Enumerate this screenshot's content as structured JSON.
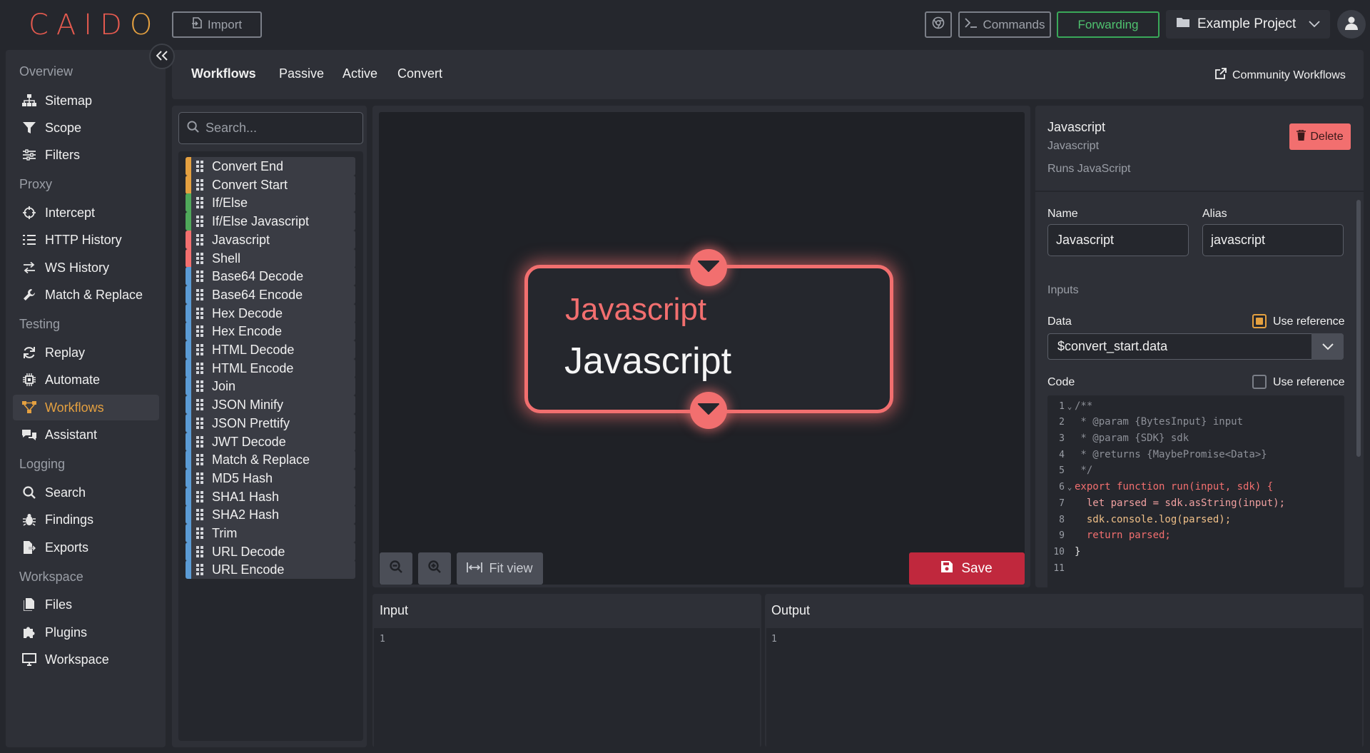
{
  "app": {
    "logo_text": "CAIDO",
    "accent": "#e4a040",
    "brand_color": "#e55a4f"
  },
  "topbar": {
    "import_label": "Import",
    "commands_label": "Commands",
    "forwarding_label": "Forwarding",
    "forwarding_color": "#4fc16f",
    "project_name": "Example Project"
  },
  "sidebar": {
    "sections": [
      {
        "title": "Overview",
        "items": [
          {
            "label": "Sitemap",
            "icon": "sitemap-icon"
          },
          {
            "label": "Scope",
            "icon": "funnel-icon"
          },
          {
            "label": "Filters",
            "icon": "sliders-icon"
          }
        ]
      },
      {
        "title": "Proxy",
        "items": [
          {
            "label": "Intercept",
            "icon": "crosshair-icon"
          },
          {
            "label": "HTTP History",
            "icon": "list-icon"
          },
          {
            "label": "WS History",
            "icon": "exchange-icon"
          },
          {
            "label": "Match & Replace",
            "icon": "wrench-icon"
          }
        ]
      },
      {
        "title": "Testing",
        "items": [
          {
            "label": "Replay",
            "icon": "refresh-icon"
          },
          {
            "label": "Automate",
            "icon": "chip-icon"
          },
          {
            "label": "Workflows",
            "icon": "workflow-icon"
          },
          {
            "label": "Assistant",
            "icon": "chat-icon"
          }
        ]
      },
      {
        "title": "Logging",
        "items": [
          {
            "label": "Search",
            "icon": "search-icon"
          },
          {
            "label": "Findings",
            "icon": "bug-icon"
          },
          {
            "label": "Exports",
            "icon": "file-export-icon"
          }
        ]
      },
      {
        "title": "Workspace",
        "items": [
          {
            "label": "Files",
            "icon": "files-icon"
          },
          {
            "label": "Plugins",
            "icon": "puzzle-icon"
          },
          {
            "label": "Workspace",
            "icon": "monitor-icon"
          }
        ]
      }
    ],
    "active_item": "Workflows"
  },
  "tabs": {
    "items": [
      "Workflows",
      "Passive",
      "Active",
      "Convert"
    ],
    "active": "Workflows",
    "community_label": "Community Workflows"
  },
  "nodes": {
    "search_placeholder": "Search...",
    "items": [
      {
        "label": "Convert End",
        "color": "#e4a040"
      },
      {
        "label": "Convert Start",
        "color": "#e4a040"
      },
      {
        "label": "If/Else",
        "color": "#4fa85a"
      },
      {
        "label": "If/Else Javascript",
        "color": "#4fa85a"
      },
      {
        "label": "Javascript",
        "color": "#f26f6f"
      },
      {
        "label": "Shell",
        "color": "#f26f6f"
      },
      {
        "label": "Base64 Decode",
        "color": "#5b9bd5"
      },
      {
        "label": "Base64 Encode",
        "color": "#5b9bd5"
      },
      {
        "label": "Hex Decode",
        "color": "#5b9bd5"
      },
      {
        "label": "Hex Encode",
        "color": "#5b9bd5"
      },
      {
        "label": "HTML Decode",
        "color": "#5b9bd5"
      },
      {
        "label": "HTML Encode",
        "color": "#5b9bd5"
      },
      {
        "label": "Join",
        "color": "#5b9bd5"
      },
      {
        "label": "JSON Minify",
        "color": "#5b9bd5"
      },
      {
        "label": "JSON Prettify",
        "color": "#5b9bd5"
      },
      {
        "label": "JWT Decode",
        "color": "#5b9bd5"
      },
      {
        "label": "Match & Replace",
        "color": "#5b9bd5"
      },
      {
        "label": "MD5 Hash",
        "color": "#5b9bd5"
      },
      {
        "label": "SHA1 Hash",
        "color": "#5b9bd5"
      },
      {
        "label": "SHA2 Hash",
        "color": "#5b9bd5"
      },
      {
        "label": "Trim",
        "color": "#5b9bd5"
      },
      {
        "label": "URL Decode",
        "color": "#5b9bd5"
      },
      {
        "label": "URL Encode",
        "color": "#5b9bd5"
      }
    ]
  },
  "canvas": {
    "node_title": "Javascript",
    "node_subtitle": "Javascript",
    "fit_view_label": "Fit view",
    "save_label": "Save"
  },
  "details": {
    "title": "Javascript",
    "subtitle": "Javascript",
    "description": "Runs JavaScript",
    "delete_label": "Delete",
    "name_label": "Name",
    "name_value": "Javascript",
    "alias_label": "Alias",
    "alias_value": "javascript",
    "inputs_label": "Inputs",
    "data_label": "Data",
    "data_use_reference_label": "Use reference",
    "data_use_reference": true,
    "data_value": "$convert_start.data",
    "code_label": "Code",
    "code_use_reference_label": "Use reference",
    "code_use_reference": false,
    "code_lines": [
      "/**",
      " * @param {BytesInput} input",
      " * @param {SDK} sdk",
      " * @returns {MaybePromise<Data>}",
      " */",
      "export function run(input, sdk) {",
      "  let parsed = sdk.asString(input);",
      "  sdk.console.log(parsed);",
      "  return parsed;",
      "}",
      ""
    ]
  },
  "io": {
    "input_label": "Input",
    "output_label": "Output",
    "input_line": "1",
    "output_line": "1"
  }
}
